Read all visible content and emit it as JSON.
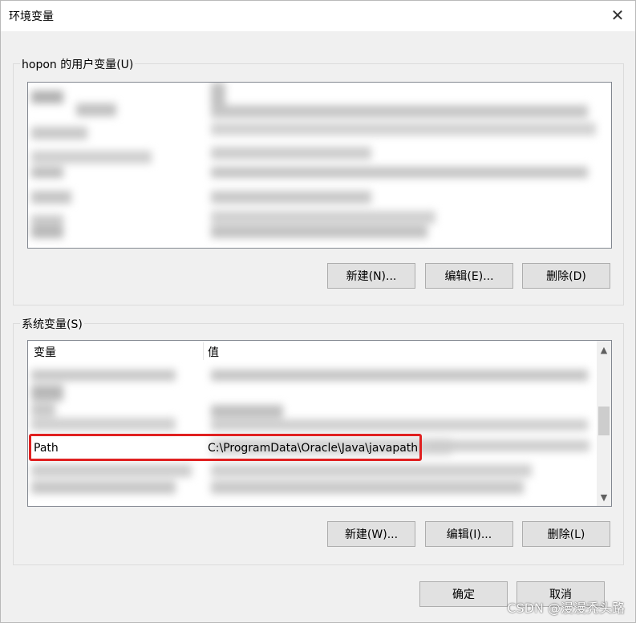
{
  "window": {
    "title": "环境变量",
    "close_symbol": "✕"
  },
  "user_vars": {
    "group_label": "hopon 的用户变量(U)",
    "buttons": {
      "new": "新建(N)...",
      "edit": "编辑(E)...",
      "delete": "删除(D)"
    }
  },
  "system_vars": {
    "group_label": "系统变量(S)",
    "columns": {
      "variable": "变量",
      "value": "值"
    },
    "selected_row": {
      "variable": "Path",
      "value": "C:\\ProgramData\\Oracle\\Java\\javapath"
    },
    "buttons": {
      "new": "新建(W)...",
      "edit": "编辑(I)...",
      "delete": "删除(L)"
    }
  },
  "footer": {
    "ok": "确定",
    "cancel": "取消"
  },
  "watermark": "CSDN @漫漫秃头路",
  "colors": {
    "highlight": "#e02020",
    "window_bg": "#f0f0f0",
    "list_bg": "#ffffff"
  }
}
